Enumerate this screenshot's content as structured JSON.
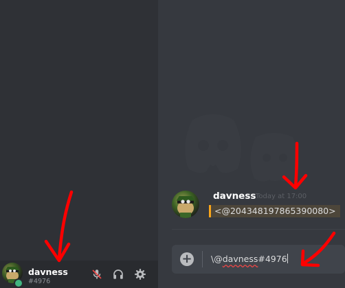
{
  "user_panel": {
    "username": "davness",
    "discriminator": "#4976",
    "status": "online",
    "buttons": [
      "mute-mic",
      "headphones",
      "settings"
    ]
  },
  "message": {
    "author": "davness",
    "timestamp": "Today at 17:00",
    "content": "<@204348197865390080>"
  },
  "input": {
    "prefix": "\\@",
    "misspelled": "davness",
    "suffix": "#4976"
  },
  "colors": {
    "background": "#36393f",
    "sidebar": "#2f3136",
    "user_panel": "#292b2f",
    "mention_accent": "#faa61a",
    "status_online": "#43b581",
    "annotation": "#ff0000",
    "muted_icon": "#f04747"
  },
  "icons": {
    "mic": "mic-muted-icon",
    "headphones": "headphones-icon",
    "settings": "gear-icon",
    "add": "plus-circle-icon"
  }
}
